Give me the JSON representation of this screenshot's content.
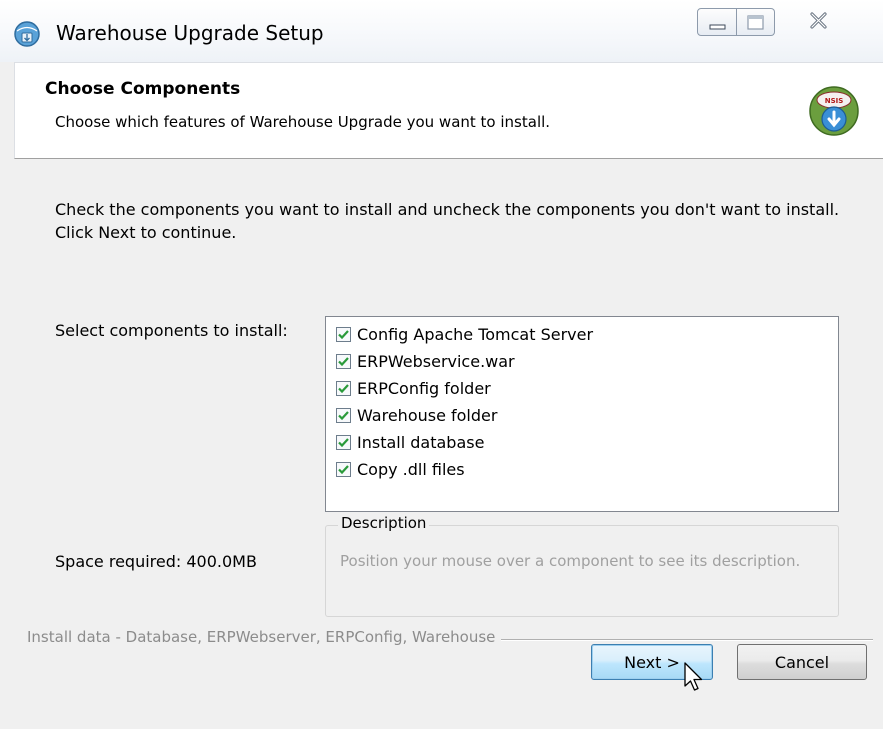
{
  "window": {
    "title": "Warehouse Upgrade Setup",
    "icons": {
      "app": "installer-globe-icon",
      "minimize": "minimize-icon",
      "maximize": "maximize-icon",
      "close": "close-icon"
    }
  },
  "header": {
    "title": "Choose Components",
    "subtitle": "Choose which features of Warehouse Upgrade you want to install.",
    "badge_text": "NSIS"
  },
  "body": {
    "intro": "Check the components you want to install and uncheck the components you don't want to install. Click Next to continue.",
    "select_label": "Select components to install:",
    "components": [
      {
        "label": "Config Apache Tomcat Server",
        "checked": true
      },
      {
        "label": "ERPWebservice.war",
        "checked": true
      },
      {
        "label": "ERPConfig folder",
        "checked": true
      },
      {
        "label": "Warehouse folder",
        "checked": true
      },
      {
        "label": "Install database",
        "checked": true
      },
      {
        "label": "Copy .dll files",
        "checked": true
      }
    ],
    "space_required": "Space required: 400.0MB",
    "description": {
      "legend": "Description",
      "text": "Position your mouse over a component to see its description."
    }
  },
  "footer": {
    "branding": "Install data - Database, ERPWebserver, ERPConfig, Warehouse",
    "next_label": "Next >",
    "cancel_label": "Cancel"
  },
  "colors": {
    "window_bg": "#f0f0f0",
    "header_bg": "#ffffff",
    "checkmark": "#2a9a3a",
    "next_button_border": "#3c7fb1",
    "description_text": "#a0a0a0"
  }
}
